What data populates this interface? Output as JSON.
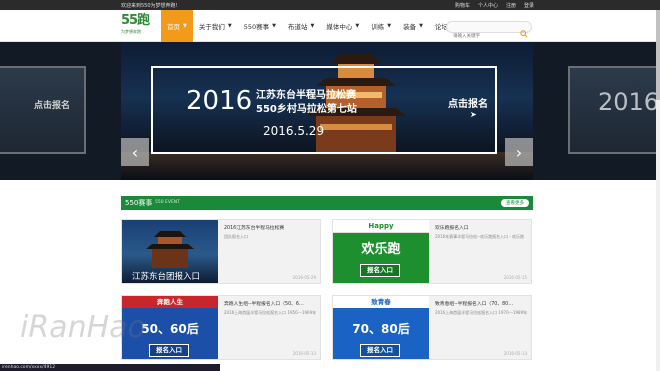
{
  "topbar": {
    "welcome": "欢迎来到550为梦想奔跑!",
    "links": [
      "购物车",
      "个人中心",
      "注册",
      "登录"
    ]
  },
  "logo": {
    "mark": "55跑",
    "sub": "为梦想奔跑"
  },
  "nav": {
    "items": [
      {
        "label": "首页",
        "active": true,
        "caret": true
      },
      {
        "label": "关于我们",
        "active": false,
        "caret": true
      },
      {
        "label": "550赛事",
        "active": false,
        "caret": true
      },
      {
        "label": "布道站",
        "active": false,
        "caret": true
      },
      {
        "label": "媒体中心",
        "active": false,
        "caret": true
      },
      {
        "label": "训练",
        "active": false,
        "caret": true
      },
      {
        "label": "装备",
        "active": false,
        "caret": true
      },
      {
        "label": "论坛",
        "active": false,
        "caret": false
      }
    ],
    "search_placeholder": "请输入关键字"
  },
  "banner": {
    "year": "2016",
    "title_line1": "江苏东台半程马拉松赛",
    "title_line2": "550乡村马拉松第七站",
    "date": "2016.5.29",
    "signup": "点击报名",
    "left_signup": "点击报名",
    "right_year": "2016"
  },
  "section": {
    "title": "550赛事",
    "subtitle": "550 EVENT",
    "more": "查看更多"
  },
  "cards": [
    {
      "thumb_caption": "江苏东台团报入口",
      "title": "2016江苏东台半程马拉松赛",
      "desc": "团队报名入口",
      "date": "2016-05-29"
    },
    {
      "thumb_top": "Happy",
      "thumb_big": "欢乐跑",
      "thumb_btn": "报名入口",
      "title": "欢乐跑报名入口",
      "desc": "2016年赛事半程马拉松--欢乐跑报名入口 - 欢乐跑",
      "date": "2016-05-15"
    },
    {
      "thumb_top": "奔跑人生",
      "thumb_big": "50、60后",
      "thumb_btn": "报名入口",
      "title": "奔跑人生组--半程报名入口（50、6…",
      "desc": "2016上海首届半程马拉松报名入口 1950---1969年",
      "date": "2016-05-13"
    },
    {
      "thumb_top": "致青春",
      "thumb_big": "70、80后",
      "thumb_btn": "报名入口",
      "title": "致青春组--半程报名入口（70、80…",
      "desc": "2016上海首届半程马拉松报名入口 1970---1989年",
      "date": "2016-05-13"
    }
  ],
  "statusbar": "irenhao.com/xxxx/4912",
  "watermark": "iRanHao"
}
